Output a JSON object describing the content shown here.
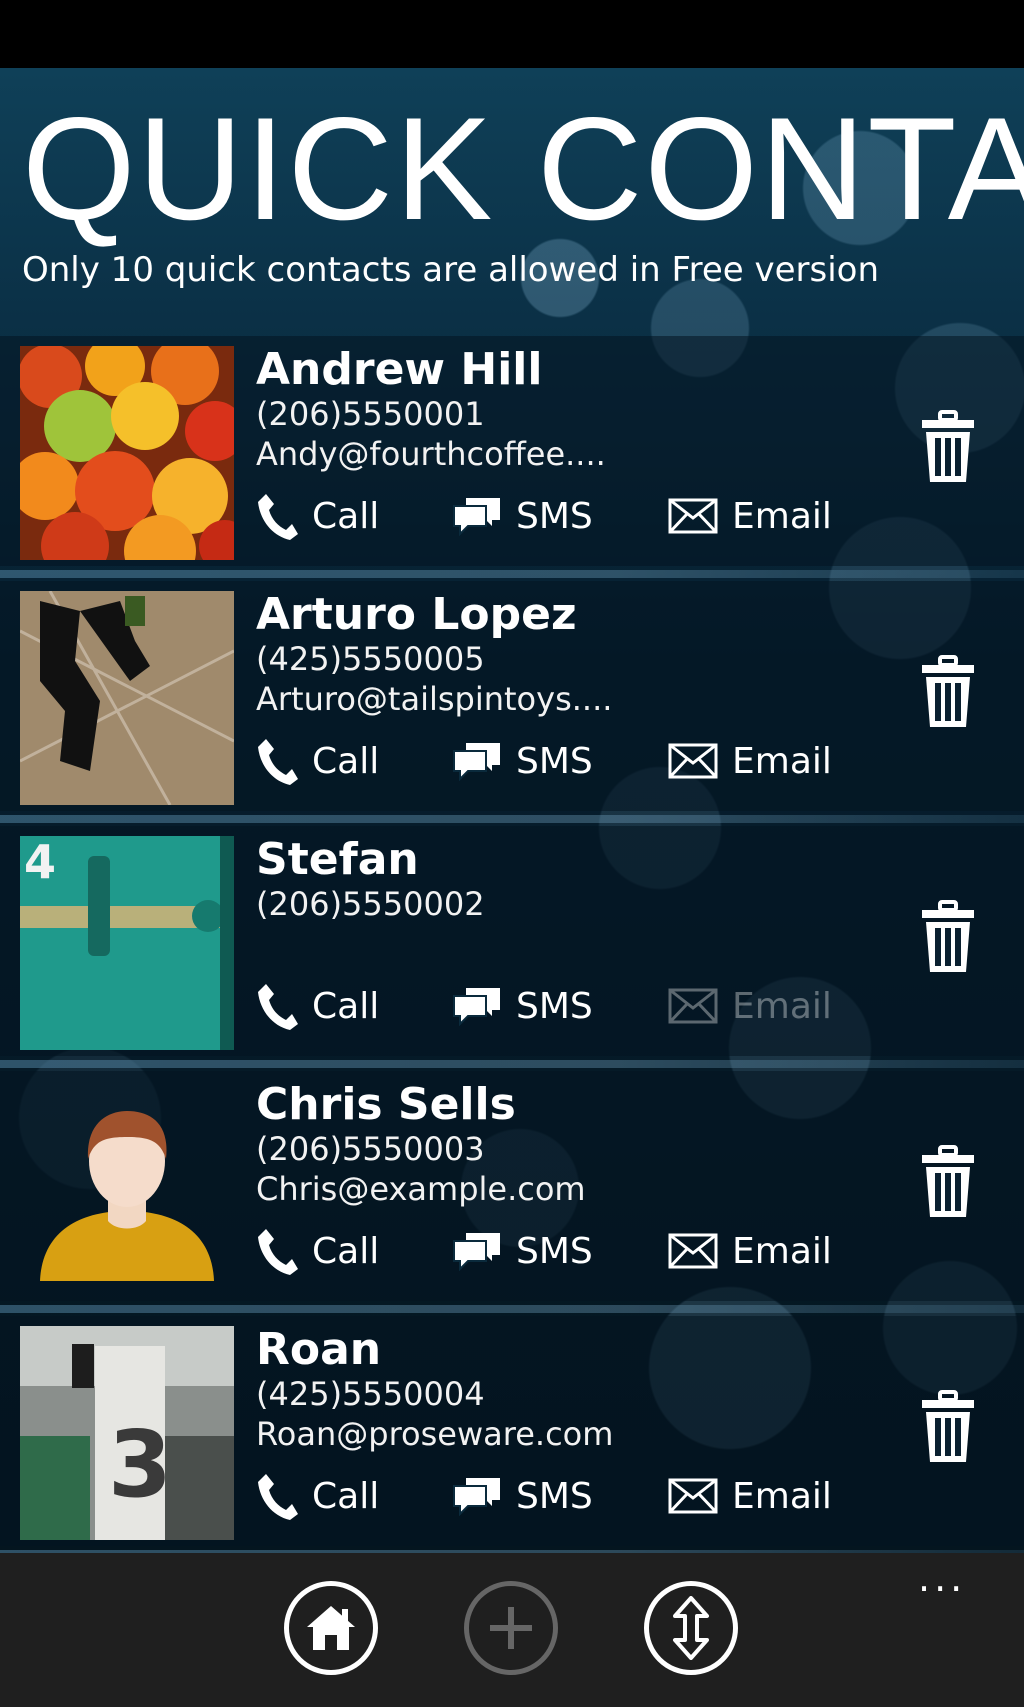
{
  "app": {
    "title": "QUICK CONTAC",
    "subtitle": "Only 10 quick contacts are allowed in Free version"
  },
  "contacts": [
    {
      "name": "Andrew Hill",
      "phone": "(206)5550001",
      "email": "Andy@fourthcoffee....",
      "email_enabled": true,
      "photo": "fruit-photo"
    },
    {
      "name": "Arturo Lopez",
      "phone": "(425)5550005",
      "email": "Arturo@tailspintoys....",
      "email_enabled": true,
      "photo": "shadow-photo"
    },
    {
      "name": "Stefan",
      "phone": "(206)5550002",
      "email": "",
      "email_enabled": false,
      "photo": "door-photo"
    },
    {
      "name": "Chris Sells",
      "phone": "(206)5550003",
      "email": "Chris@example.com",
      "email_enabled": true,
      "photo": "default-avatar"
    },
    {
      "name": "Roan",
      "phone": "(425)5550004",
      "email": "Roan@proseware.com",
      "email_enabled": true,
      "photo": "pillar-photo"
    }
  ],
  "actions": {
    "call_label": "Call",
    "sms_label": "SMS",
    "email_label": "Email"
  },
  "app_bar": {
    "buttons": [
      {
        "icon": "home-icon",
        "enabled": true
      },
      {
        "icon": "add-icon",
        "enabled": false
      },
      {
        "icon": "reorder-icon",
        "enabled": true
      }
    ],
    "more": "..."
  },
  "colors": {
    "header_bg": "#0f4058",
    "list_bg": "#04151f",
    "app_bar_bg": "#1f1f1f",
    "text": "#ffffff"
  }
}
